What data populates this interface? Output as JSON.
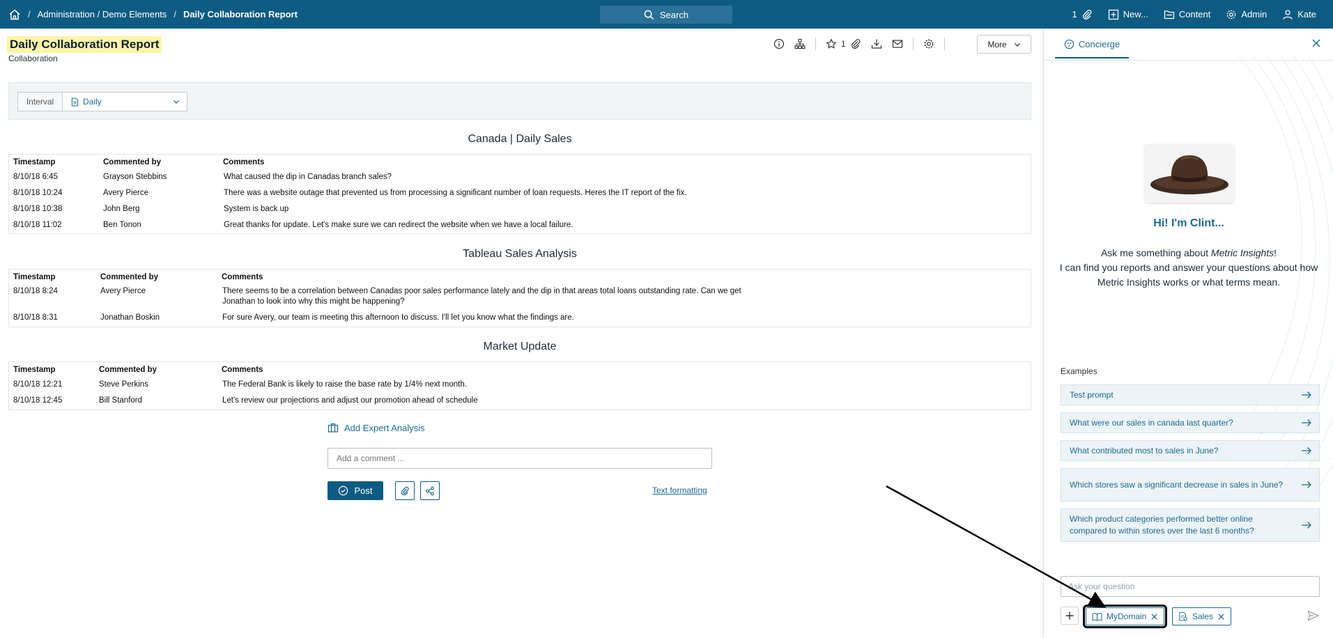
{
  "topbar": {
    "breadcrumb_path": "Administration / Demo Elements",
    "breadcrumb_sep": "/",
    "breadcrumb_current": "Daily Collaboration Report",
    "search_label": "Search",
    "attach_count": "1",
    "new_label": "New...",
    "content_label": "Content",
    "admin_label": "Admin",
    "user_label": "Kate"
  },
  "report": {
    "title": "Daily Collaboration Report",
    "subtitle": "Collaboration",
    "attach_count": "1",
    "more_label": "More"
  },
  "filter": {
    "label": "Interval",
    "value": "Daily"
  },
  "sections": [
    {
      "title": "Canada | Daily Sales",
      "headers": [
        "Timestamp",
        "Commented by",
        "Comments"
      ],
      "rows": [
        [
          "8/10/18 6:45",
          "Grayson Stebbins",
          "What caused the dip in Canadas branch sales?"
        ],
        [
          "8/10/18 10:24",
          "Avery Pierce",
          "There was a website outage that prevented us from processing a significant number of loan requests. Heres the IT report of the fix."
        ],
        [
          "8/10/18 10:38",
          "John Berg",
          "System is back up"
        ],
        [
          "8/10/18 11:02",
          "Ben Tonon",
          "Great thanks for update. Let's make sure we can redirect the website when we have a local failure."
        ]
      ]
    },
    {
      "title": "Tableau Sales Analysis",
      "headers": [
        "Timestamp",
        "Commented by",
        "Comments"
      ],
      "rows": [
        [
          "8/10/18 8:24",
          "Avery Pierce",
          "There seems to be a correlation between Canadas poor sales performance lately and the dip in that areas total loans outstanding rate. Can we get Jonathan to look into why this might be happening?"
        ],
        [
          "8/10/18 8:31",
          "Jonathan Boskin",
          "For sure Avery, our team is meeting this afternoon to discuss. I'll let you know what the findings are."
        ]
      ]
    },
    {
      "title": "Market Update",
      "headers": [
        "Timestamp",
        "Commented by",
        "Comments"
      ],
      "rows": [
        [
          "8/10/18 12:21",
          "Steve Perkins",
          "The Federal Bank is likely to raise the base rate by 1/4% next month."
        ],
        [
          "8/10/18 12:45",
          "Bill Stanford",
          "Let's review our projections and adjust our promotion ahead of schedule"
        ]
      ]
    }
  ],
  "comments": {
    "add_expert_label": "Add Expert Analysis",
    "input_placeholder": "Add a comment ...",
    "post_label": "Post",
    "text_formatting_label": "Text formatting"
  },
  "concierge": {
    "tab_label": "Concierge",
    "greeting": "Hi! I'm Clint...",
    "intro_prefix": "Ask me something about ",
    "intro_brand": "Metric Insights",
    "intro_suffix": "!",
    "intro_line2": "I can find you reports and answer your questions about how Metric Insights works or what terms mean.",
    "examples_label": "Examples",
    "examples": [
      "Test prompt",
      "What were our sales in canada last quarter?",
      "What contributed most to sales in June?",
      "Which stores saw a significant decrease in sales in June?",
      "Which product categories performed better online compared to within stores over the last 6 months?"
    ],
    "ask_placeholder": "Ask your question",
    "chips": [
      "MyDomain",
      "Sales"
    ]
  },
  "colors": {
    "primary": "#0d5b82",
    "link": "#1d6a94",
    "title_highlight": "#fbf5a7",
    "example_bg": "#edf4f8"
  }
}
